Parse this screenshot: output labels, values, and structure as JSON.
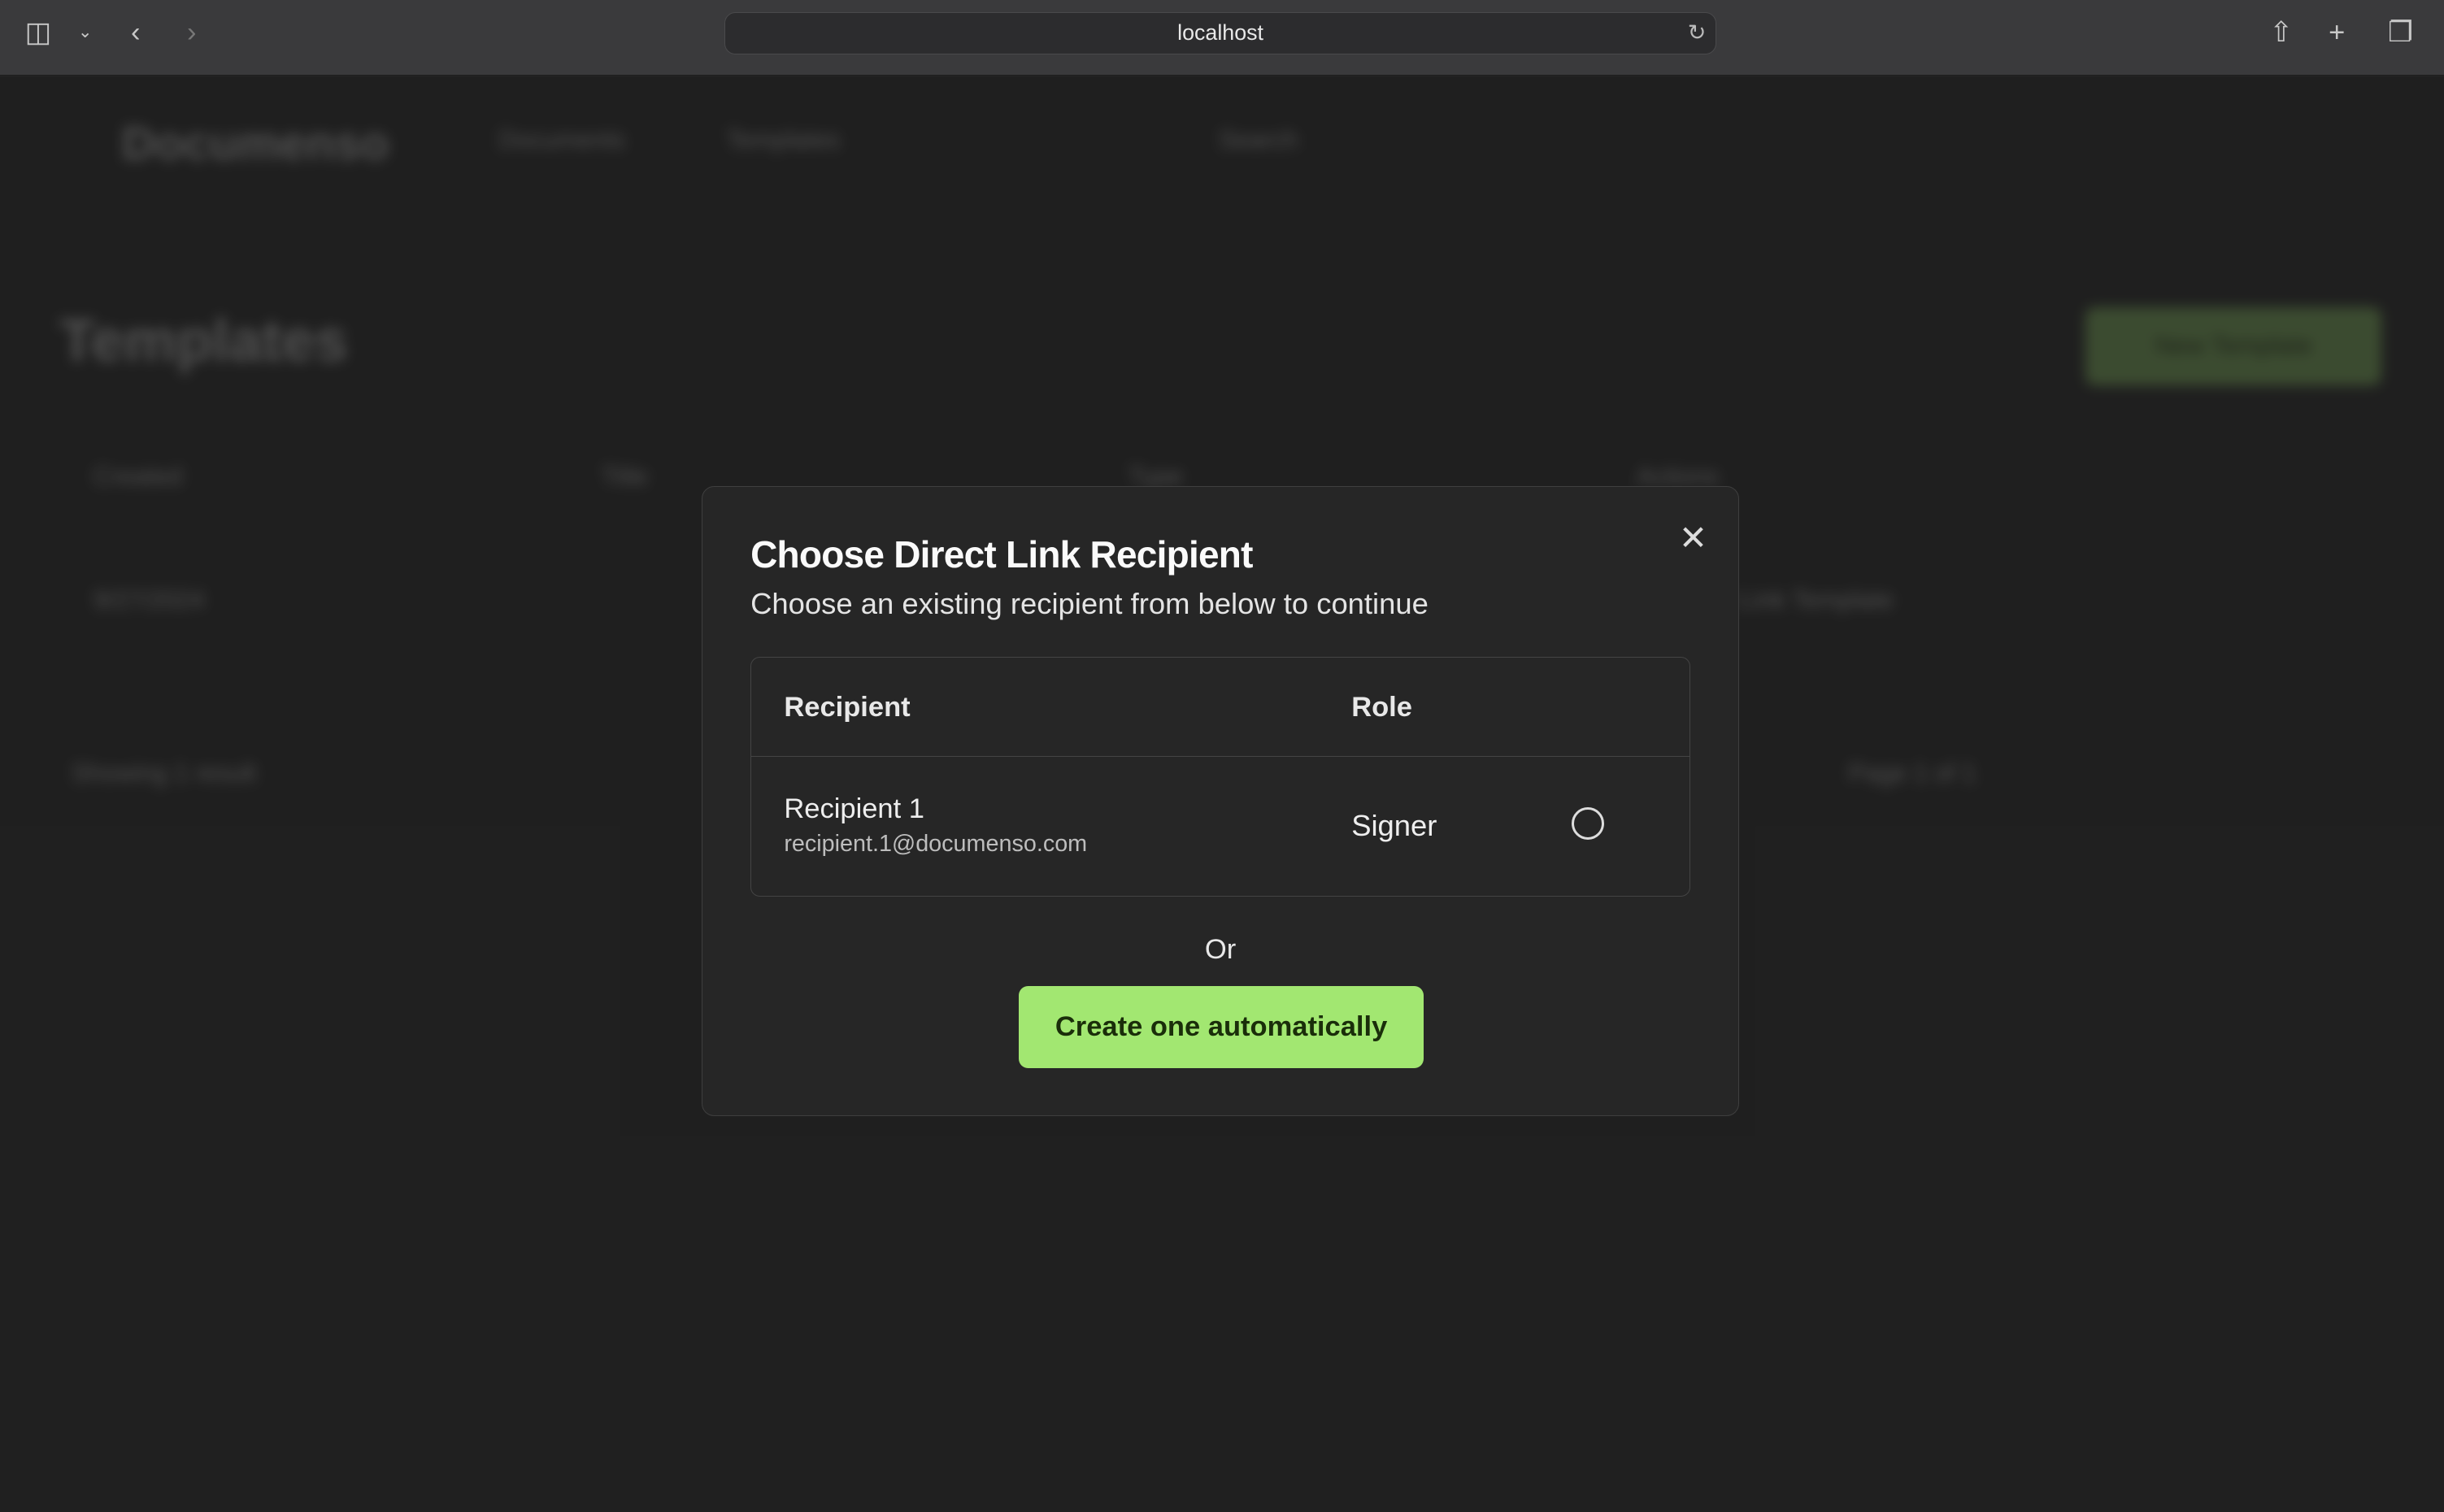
{
  "browser": {
    "url": "localhost"
  },
  "background": {
    "logo": "Documenso",
    "nav": [
      "Documents",
      "Templates"
    ],
    "search": "Search",
    "page_title": "Templates",
    "new_template": "New Template",
    "columns": [
      "Created",
      "Title",
      "Type",
      "Actions"
    ],
    "row": {
      "created": "9/27/2024",
      "type": "Direct Link Template"
    },
    "showing": "Showing 1 result",
    "page": "Page 1 of 1"
  },
  "modal": {
    "title": "Choose Direct Link Recipient",
    "subtitle": "Choose an existing recipient from below to continue",
    "columns": {
      "recipient": "Recipient",
      "role": "Role"
    },
    "recipients": [
      {
        "name": "Recipient 1",
        "email": "recipient.1@documenso.com",
        "role": "Signer",
        "selected": false
      }
    ],
    "or": "Or",
    "create_button": "Create one automatically"
  },
  "colors": {
    "accent": "#a2e771",
    "background": "#262626"
  }
}
